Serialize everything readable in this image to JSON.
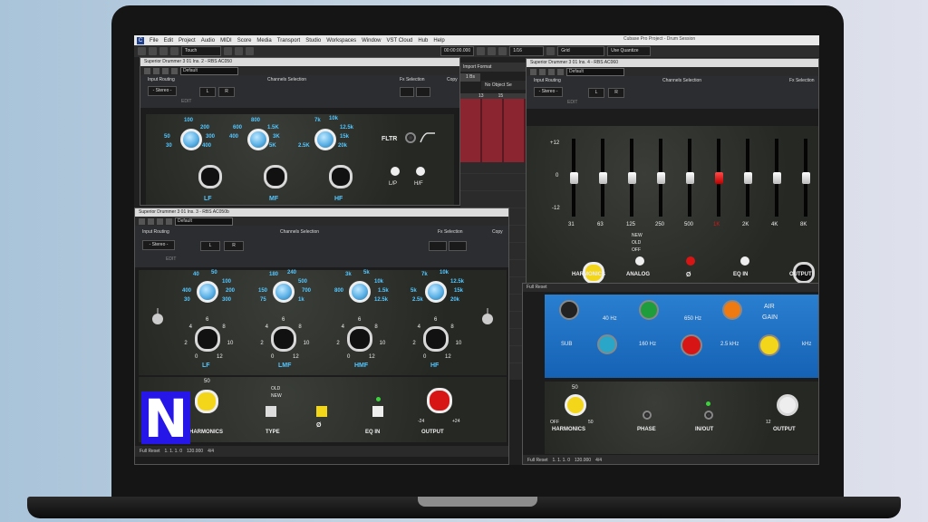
{
  "host": {
    "menu": [
      "File",
      "Edit",
      "Project",
      "Audio",
      "MIDI",
      "Score",
      "Media",
      "Transport",
      "Studio",
      "Workspaces",
      "Window",
      "VST Cloud",
      "Hub",
      "Help"
    ],
    "window_title": "Cubase Pro Project - Drum Session",
    "toolbar": {
      "mode": "Touch",
      "time": "00:00:00.000",
      "grid": "Grid",
      "quantize": "Use Quantize",
      "fraction": "1/16"
    },
    "ruler": [
      "13",
      "15"
    ],
    "format_text": "Import Format",
    "no_object": "No Object Se",
    "bars_left": "1 Bs"
  },
  "plugins": [
    {
      "title": "Superior Drummer 3 01 Ins. 2 - RBS AC050",
      "preset": "Default",
      "input_routing": "Input Routing",
      "routing_value": "- Stereo -",
      "edit": "EDIT",
      "channels_selection": "Channels Selection",
      "channel_btns": [
        "L",
        "R"
      ],
      "fx_selection": "Fx Selection",
      "copy": "Copy",
      "fltr": "FLTR",
      "switch_labels": [
        "L/P",
        "H/F"
      ],
      "bands": [
        {
          "label": "LF",
          "freqs": [
            "100",
            "200",
            "300",
            "400",
            "30",
            "50"
          ]
        },
        {
          "label": "MF",
          "freqs": [
            "800",
            "1.5K",
            "3K",
            "5K",
            "400",
            "600"
          ]
        },
        {
          "label": "HF",
          "freqs": [
            "7k",
            "10k",
            "12.5k",
            "15k",
            "20k",
            "2.5K"
          ]
        }
      ]
    },
    {
      "title": "Superior Drummer 3 01 Ins. 3 - RBS AC050b",
      "preset": "Default",
      "input_routing": "Input Routing",
      "routing_value": "- Stereo -",
      "edit": "EDIT",
      "channels_selection": "Channels Selection",
      "channel_btns": [
        "L",
        "R"
      ],
      "fx_selection": "Fx Selection",
      "copy": "Copy",
      "bands": [
        {
          "label": "LF",
          "freqs": [
            "40",
            "50",
            "100",
            "200",
            "300",
            "400",
            "30"
          ]
        },
        {
          "label": "LMF",
          "freqs": [
            "180",
            "240",
            "500",
            "700",
            "1k",
            "150",
            "75"
          ]
        },
        {
          "label": "HMF",
          "freqs": [
            "3k",
            "5k",
            "10k",
            "1.5k",
            "12.5k",
            "800"
          ]
        },
        {
          "label": "HF",
          "freqs": [
            "7k",
            "10k",
            "12.5k",
            "15k",
            "20k",
            "5k",
            "2.5k"
          ]
        }
      ],
      "gain_scale": [
        "0",
        "2",
        "4",
        "6",
        "8",
        "10",
        "12"
      ],
      "bottom": {
        "harmonics": "HARMONICS",
        "harmonics_max": "50",
        "type": "TYPE",
        "type_opts": [
          "OLD",
          "NEW"
        ],
        "phase": "Ø",
        "eq_in": "EQ IN",
        "output": "OUTPUT",
        "output_min": "-24",
        "output_max": "+24"
      },
      "status": {
        "preset": "Full Reset",
        "pos": "1. 1. 1. 0",
        "tempo": "120.000",
        "sig": "4/4"
      }
    },
    {
      "title": "Superior Drummer 3 01 Ins. 4 - RBS AC060",
      "preset": "Default",
      "input_routing": "Input Routing",
      "routing_value": "- Stereo -",
      "edit": "EDIT",
      "channels_selection": "Channels Selection",
      "channel_btns": [
        "L",
        "R"
      ],
      "fx_selection": "Fx Selection",
      "db_scale": [
        "+12",
        "0",
        "-12"
      ],
      "bands": [
        "31",
        "63",
        "125",
        "250",
        "500",
        "1K",
        "2K",
        "4K",
        "8K"
      ],
      "band_levels": [
        0,
        0,
        0,
        0,
        0,
        0,
        0,
        0,
        0
      ],
      "highlight_band": "1K",
      "harmonics": "HARMONICS",
      "harmonics_min": "20",
      "harmonics_max": "50",
      "analog": "ANALOG",
      "analog_opts": [
        "NEW",
        "OLD",
        "OFF"
      ],
      "phase": "Ø",
      "eq_in": "EQ IN",
      "output": "OUTPUT"
    },
    {
      "title": "Full Reset",
      "top_labels": [
        "40 Hz",
        "650 Hz",
        "AIR",
        "GAIN"
      ],
      "mid_labels": [
        "SUB",
        "160 Hz",
        "2.5 kHz",
        "kHz"
      ],
      "bottom": {
        "harmonics": "HARMONICS",
        "harmonics_min": "OFF",
        "harmonics_max": "50",
        "harmonics_top": "50",
        "phase": "PHASE",
        "inout": "IN/OUT",
        "output": "OUTPUT",
        "output_min": "12"
      },
      "status": {
        "preset": "Full Reset",
        "pos": "1. 1. 1. 0",
        "tempo": "120.000",
        "sig": "4/4"
      }
    }
  ],
  "colors": {
    "blue_knob": "#5ab0e6",
    "eq_blue": "#1d6fc4",
    "accent_red": "#d81515",
    "yellow": "#f3d51a"
  },
  "logo": "N"
}
